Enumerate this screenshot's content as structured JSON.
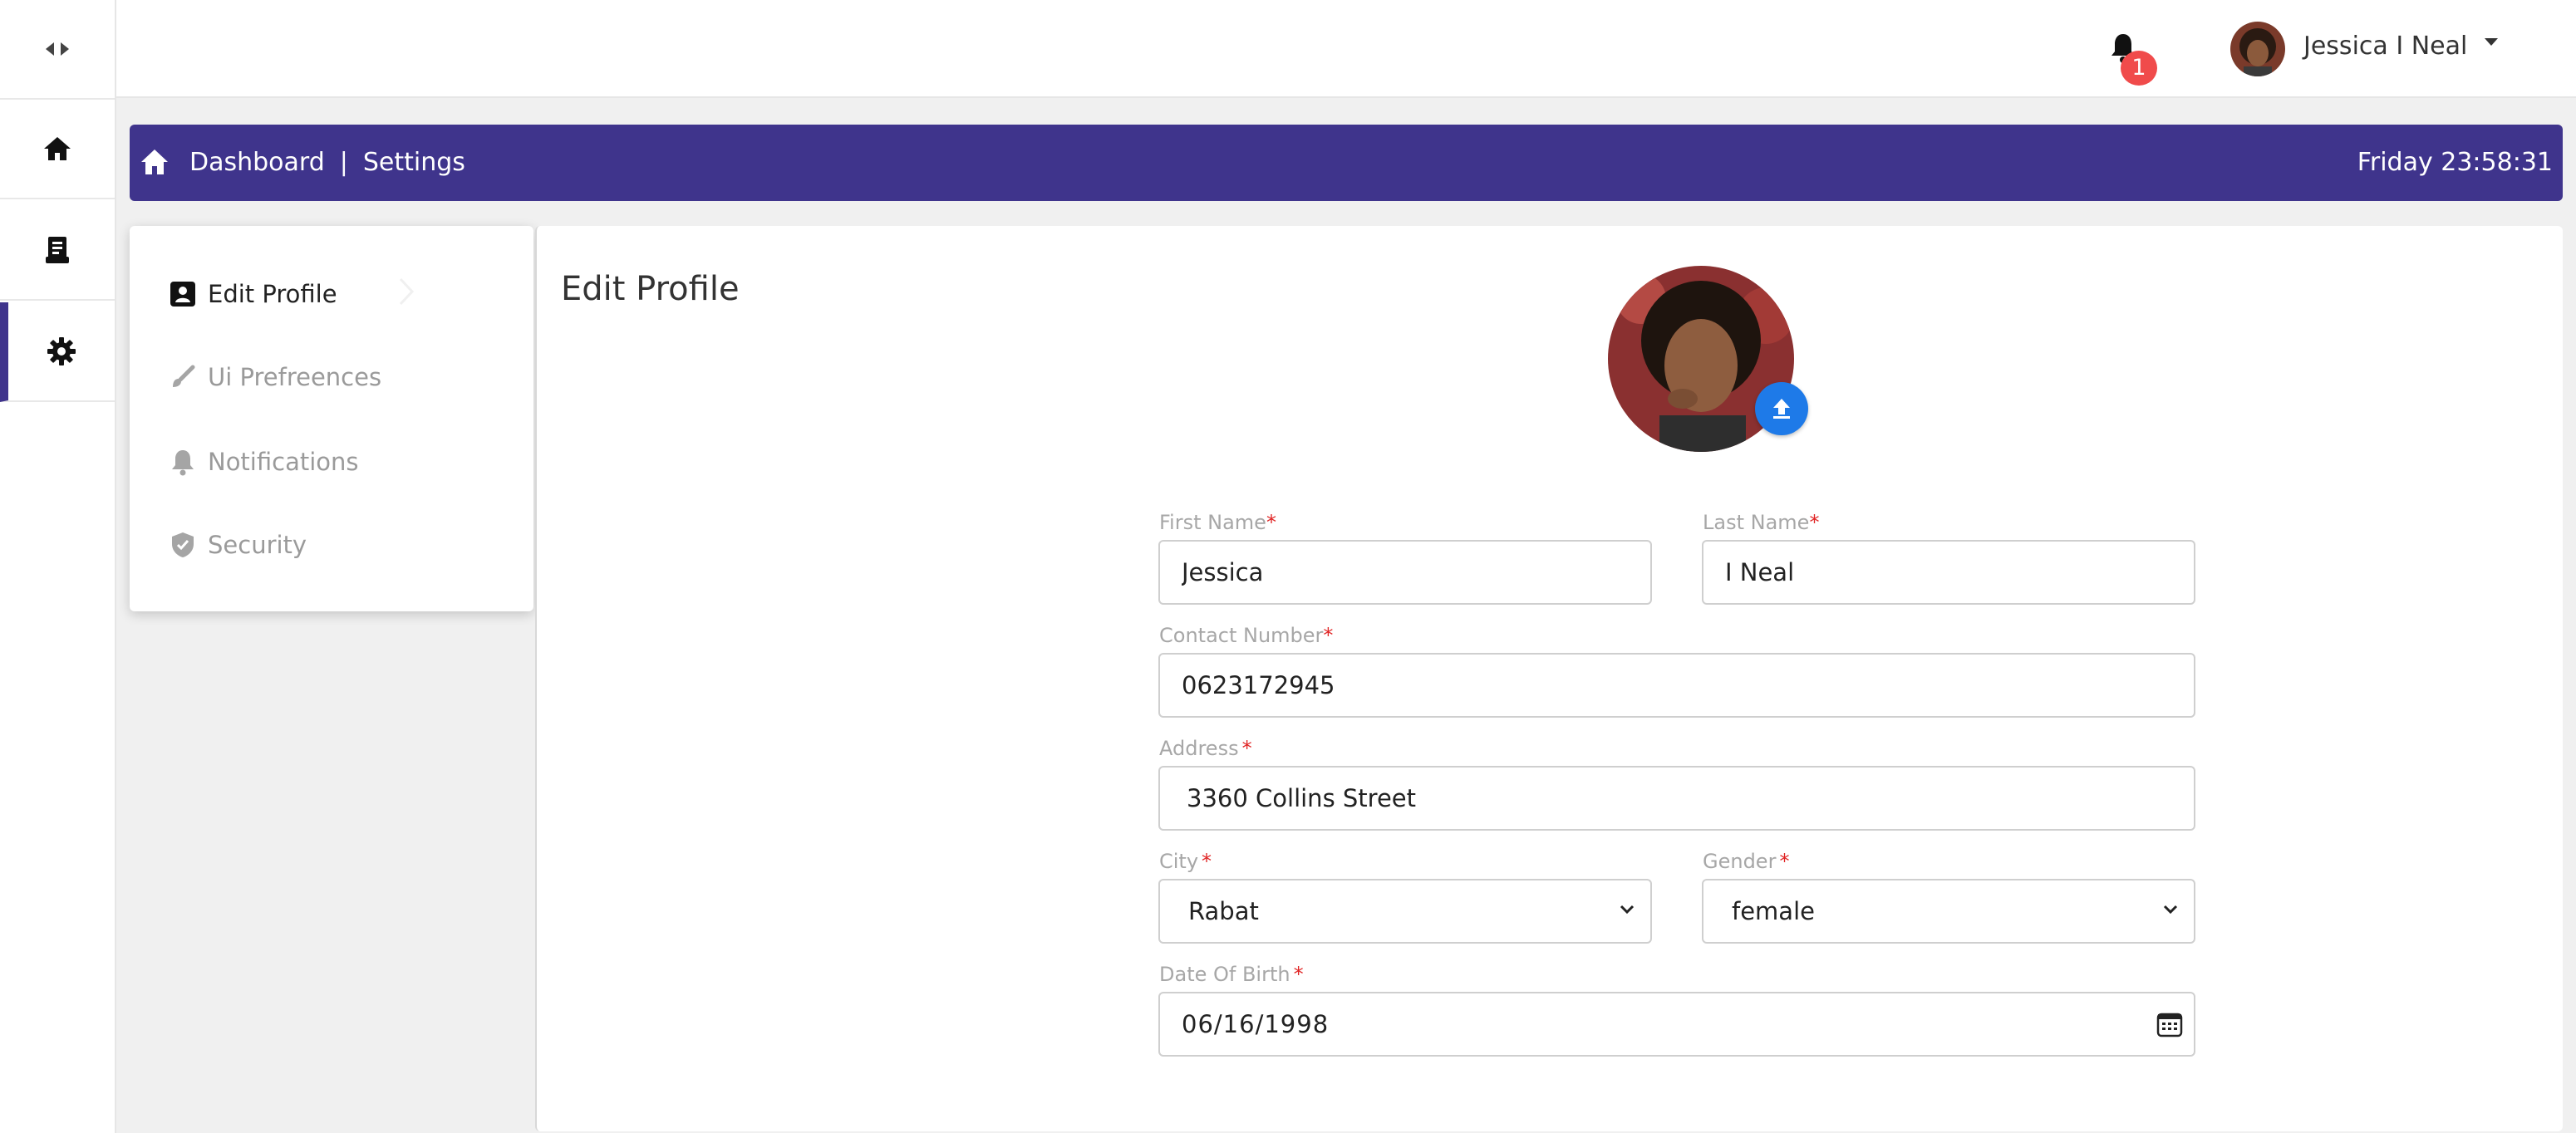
{
  "app": {
    "colors": {
      "primary": "#3f348c",
      "accent": "#1e7ae8",
      "badge": "#f04b4b",
      "required": "#e02424"
    },
    "rail": {
      "toggle_icon": "collapse-expand-icon",
      "items": [
        {
          "icon": "home-icon"
        },
        {
          "icon": "document-icon"
        },
        {
          "icon": "gear-icon",
          "active": true
        }
      ]
    },
    "topbar": {
      "notifications_count": "1",
      "user_name": "Jessica I Neal"
    },
    "breadcrumb": {
      "home": "Dashboard",
      "separator": "|",
      "current": "Settings",
      "datetime": "Friday 23:58:31"
    },
    "settings_menu": {
      "items": [
        {
          "label": "Edit Profile",
          "icon": "contact-card-icon",
          "active": true
        },
        {
          "label": "Ui Prefreences",
          "icon": "brush-icon"
        },
        {
          "label": "Notifications",
          "icon": "bell-icon"
        },
        {
          "label": "Security",
          "icon": "shield-icon"
        }
      ]
    },
    "profile": {
      "title": "Edit Profile",
      "fields": {
        "first_name": {
          "label": "First Name",
          "value": "Jessica",
          "required": "*"
        },
        "last_name": {
          "label": "Last Name",
          "value": "I Neal",
          "required": "*"
        },
        "contact": {
          "label": "Contact Number",
          "value": "0623172945",
          "required": "*"
        },
        "address": {
          "label": "Address",
          "value": "3360 Collins Street",
          "required": "*"
        },
        "city": {
          "label": "City",
          "value": "Rabat",
          "required": "*"
        },
        "gender": {
          "label": "Gender",
          "value": "female",
          "required": "*"
        },
        "dob": {
          "label": "Date Of Birth",
          "value": "06/16/1998",
          "required": "*"
        }
      }
    }
  }
}
